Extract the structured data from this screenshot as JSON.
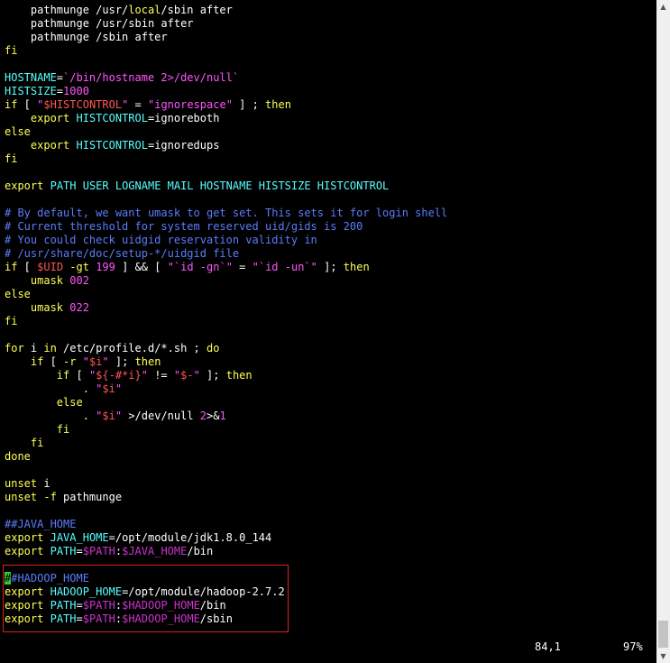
{
  "colors": {
    "background": "#000000",
    "cursor": "#33cc33",
    "highlight_box": "#dd2222",
    "scrollbar": "#f0f0f0",
    "scroll_thumb": "#c4c4c4"
  },
  "lines": [
    [
      [
        "w",
        "    pathmunge /usr/"
      ],
      [
        "y",
        "local"
      ],
      [
        "w",
        "/sbin after"
      ]
    ],
    [
      [
        "w",
        "    pathmunge /usr/sbin after"
      ]
    ],
    [
      [
        "w",
        "    pathmunge /sbin after"
      ]
    ],
    [
      [
        "y",
        "fi"
      ]
    ],
    [],
    [
      [
        "c",
        "HOSTNAME"
      ],
      [
        "w",
        "="
      ],
      [
        "m",
        "`/bin/hostname 2>/dev/null`"
      ]
    ],
    [
      [
        "c",
        "HISTSIZE"
      ],
      [
        "w",
        "="
      ],
      [
        "m",
        "1000"
      ]
    ],
    [
      [
        "y",
        "if"
      ],
      [
        "w",
        " [ "
      ],
      [
        "m",
        "\""
      ],
      [
        "r",
        "$HISTCONTROL"
      ],
      [
        "m",
        "\""
      ],
      [
        "w",
        " = "
      ],
      [
        "m",
        "\"ignorespace\""
      ],
      [
        "w",
        " ] ; "
      ],
      [
        "y",
        "then"
      ]
    ],
    [
      [
        "w",
        "    "
      ],
      [
        "y",
        "export"
      ],
      [
        "w",
        " "
      ],
      [
        "c",
        "HISTCONTROL"
      ],
      [
        "w",
        "=ignoreboth"
      ]
    ],
    [
      [
        "y",
        "else"
      ]
    ],
    [
      [
        "w",
        "    "
      ],
      [
        "y",
        "export"
      ],
      [
        "w",
        " "
      ],
      [
        "c",
        "HISTCONTROL"
      ],
      [
        "w",
        "=ignoredups"
      ]
    ],
    [
      [
        "y",
        "fi"
      ]
    ],
    [],
    [
      [
        "y",
        "export"
      ],
      [
        "w",
        " "
      ],
      [
        "c",
        "PATH USER LOGNAME MAIL HOSTNAME HISTSIZE HISTCONTROL"
      ]
    ],
    [],
    [
      [
        "b",
        "# By default, we want umask to get set. This sets it for login shell"
      ]
    ],
    [
      [
        "b",
        "# Current threshold for system reserved uid/gids is 200"
      ]
    ],
    [
      [
        "b",
        "# You could check uidgid reservation validity in"
      ]
    ],
    [
      [
        "b",
        "# /usr/share/doc/setup-*/uidgid file"
      ]
    ],
    [
      [
        "y",
        "if"
      ],
      [
        "w",
        " [ "
      ],
      [
        "r",
        "$UID"
      ],
      [
        "w",
        " "
      ],
      [
        "y",
        "-gt"
      ],
      [
        "w",
        " "
      ],
      [
        "m",
        "199"
      ],
      [
        "w",
        " ] && [ "
      ],
      [
        "m",
        "\"`id -gn`\""
      ],
      [
        "w",
        " = "
      ],
      [
        "m",
        "\"`id -un`\""
      ],
      [
        "w",
        " ]; "
      ],
      [
        "y",
        "then"
      ]
    ],
    [
      [
        "w",
        "    "
      ],
      [
        "y",
        "umask"
      ],
      [
        "w",
        " "
      ],
      [
        "m",
        "002"
      ]
    ],
    [
      [
        "y",
        "else"
      ]
    ],
    [
      [
        "w",
        "    "
      ],
      [
        "y",
        "umask"
      ],
      [
        "w",
        " "
      ],
      [
        "m",
        "022"
      ]
    ],
    [
      [
        "y",
        "fi"
      ]
    ],
    [],
    [
      [
        "y",
        "for"
      ],
      [
        "w",
        " i "
      ],
      [
        "y",
        "in"
      ],
      [
        "w",
        " /etc/profile.d/*.sh ; "
      ],
      [
        "y",
        "do"
      ]
    ],
    [
      [
        "w",
        "    "
      ],
      [
        "y",
        "if"
      ],
      [
        "w",
        " [ "
      ],
      [
        "y",
        "-r"
      ],
      [
        "w",
        " "
      ],
      [
        "m",
        "\""
      ],
      [
        "r",
        "$i"
      ],
      [
        "m",
        "\""
      ],
      [
        "w",
        " ]; "
      ],
      [
        "y",
        "then"
      ]
    ],
    [
      [
        "w",
        "        "
      ],
      [
        "y",
        "if"
      ],
      [
        "w",
        " [ "
      ],
      [
        "m",
        "\""
      ],
      [
        "r",
        "${-#*i}"
      ],
      [
        "m",
        "\""
      ],
      [
        "w",
        " != "
      ],
      [
        "m",
        "\""
      ],
      [
        "r",
        "$-"
      ],
      [
        "m",
        "\""
      ],
      [
        "w",
        " ]; "
      ],
      [
        "y",
        "then"
      ]
    ],
    [
      [
        "w",
        "            "
      ],
      [
        "y",
        "."
      ],
      [
        "w",
        " "
      ],
      [
        "m",
        "\""
      ],
      [
        "r",
        "$i"
      ],
      [
        "m",
        "\""
      ]
    ],
    [
      [
        "w",
        "        "
      ],
      [
        "y",
        "else"
      ]
    ],
    [
      [
        "w",
        "            "
      ],
      [
        "y",
        "."
      ],
      [
        "w",
        " "
      ],
      [
        "m",
        "\""
      ],
      [
        "r",
        "$i"
      ],
      [
        "m",
        "\""
      ],
      [
        "w",
        " >/dev/null "
      ],
      [
        "m",
        "2"
      ],
      [
        "w",
        ">&"
      ],
      [
        "m",
        "1"
      ]
    ],
    [
      [
        "w",
        "        "
      ],
      [
        "y",
        "fi"
      ]
    ],
    [
      [
        "w",
        "    "
      ],
      [
        "y",
        "fi"
      ]
    ],
    [
      [
        "y",
        "done"
      ]
    ],
    [],
    [
      [
        "y",
        "unset"
      ],
      [
        "w",
        " i"
      ]
    ],
    [
      [
        "y",
        "unset"
      ],
      [
        "w",
        " "
      ],
      [
        "y",
        "-f"
      ],
      [
        "w",
        " pathmunge"
      ]
    ],
    [],
    [
      [
        "b",
        "##JAVA_HOME"
      ]
    ],
    [
      [
        "y",
        "export"
      ],
      [
        "w",
        " "
      ],
      [
        "c",
        "JAVA_HOME"
      ],
      [
        "w",
        "=/opt/module/jdk1.8.0_144"
      ]
    ],
    [
      [
        "y",
        "export"
      ],
      [
        "w",
        " "
      ],
      [
        "c",
        "PATH"
      ],
      [
        "w",
        "="
      ],
      [
        "d",
        "$PATH"
      ],
      [
        "w",
        ":"
      ],
      [
        "d",
        "$JAVA_HOME"
      ],
      [
        "w",
        "/bin"
      ]
    ],
    [],
    [
      [
        "k",
        "#"
      ],
      [
        "b",
        "#HADOOP_HOME"
      ]
    ],
    [
      [
        "y",
        "export"
      ],
      [
        "w",
        " "
      ],
      [
        "c",
        "HADOOP_HOME"
      ],
      [
        "w",
        "=/opt/module/hadoop-2.7.2"
      ]
    ],
    [
      [
        "y",
        "export"
      ],
      [
        "w",
        " "
      ],
      [
        "c",
        "PATH"
      ],
      [
        "w",
        "="
      ],
      [
        "d",
        "$PATH"
      ],
      [
        "w",
        ":"
      ],
      [
        "d",
        "$HADOOP_HOME"
      ],
      [
        "w",
        "/bin"
      ]
    ],
    [
      [
        "y",
        "export"
      ],
      [
        "w",
        " "
      ],
      [
        "c",
        "PATH"
      ],
      [
        "w",
        "="
      ],
      [
        "d",
        "$PATH"
      ],
      [
        "w",
        ":"
      ],
      [
        "d",
        "$HADOOP_HOME"
      ],
      [
        "w",
        "/sbin"
      ]
    ]
  ],
  "status": {
    "cursor_position": "84,1",
    "scroll_percent": "97%"
  },
  "scrollbar": {
    "up_icon": "▲",
    "down_icon": "▼",
    "position_fraction": 0.97
  }
}
